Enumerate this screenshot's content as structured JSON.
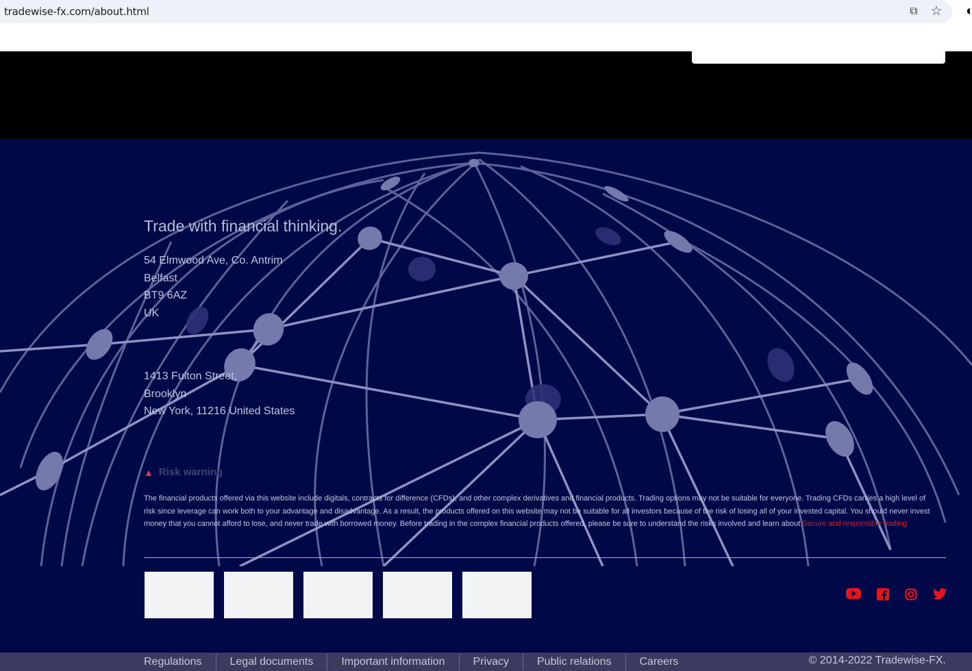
{
  "browser": {
    "url": "tradewise-fx.com/about.html",
    "icons": [
      "translate-icon",
      "star-icon",
      "profile-icon"
    ]
  },
  "footer": {
    "title": "Trade with financial thinking.",
    "address_uk": [
      "54 Elmwood Ave, Co. Antrim",
      "Belfast",
      "BT9 6AZ",
      "UK"
    ],
    "address_us": [
      "1413 Fulton Street,",
      "Brooklyn",
      "New York, 11216 United States"
    ],
    "risk": {
      "heading": "Risk warning",
      "text": "The financial products offered via this website include digitals, contracts for difference (CFDs), and other complex derivatives and financial products. Trading options may not be suitable for everyone. Trading CFDs carries a high level of risk since leverage can work both to your advantage and disadvantage. As a result, the products offered on this website may not be suitable for all investors because of the risk of losing all of your invested capital. You should never invest money that you cannot afford to lose, and never trade with borrowed money. Before trading in the complex financial products offered, please be sure to understand the risks involved and learn about ",
      "link": "Secure and responsible trading"
    },
    "social": [
      "youtube-icon",
      "facebook-icon",
      "instagram-icon",
      "twitter-icon"
    ]
  },
  "bottom_nav": {
    "items": [
      "Regulations",
      "Legal documents",
      "Important information",
      "Privacy",
      "Public relations",
      "Careers"
    ],
    "copyright": "© 2014-2022 Tradewise-FX."
  },
  "colors": {
    "footer_bg": "#000848",
    "accent_red": "#e1151e",
    "bottom_bar": "#3b3b5f"
  }
}
